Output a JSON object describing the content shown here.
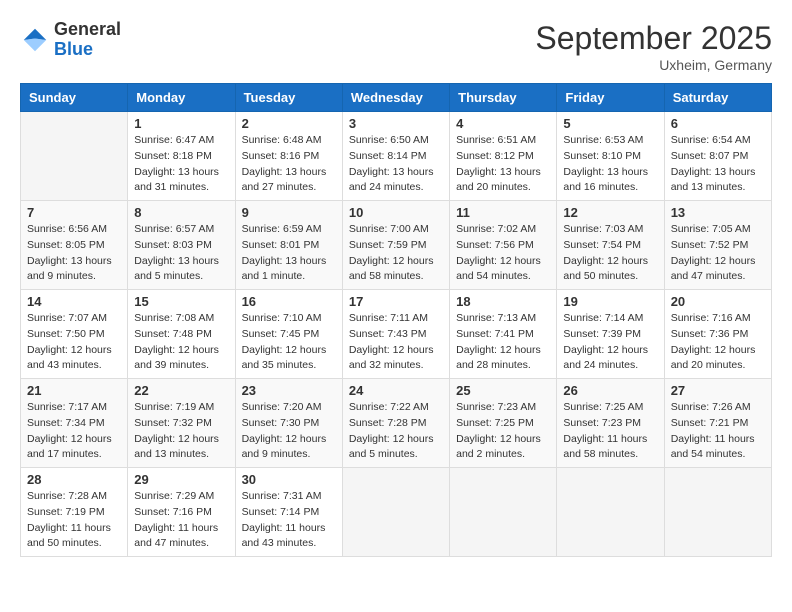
{
  "logo": {
    "general": "General",
    "blue": "Blue"
  },
  "header": {
    "month": "September 2025",
    "location": "Uxheim, Germany"
  },
  "weekdays": [
    "Sunday",
    "Monday",
    "Tuesday",
    "Wednesday",
    "Thursday",
    "Friday",
    "Saturday"
  ],
  "weeks": [
    [
      {
        "day": null
      },
      {
        "day": 1,
        "sunrise": "6:47 AM",
        "sunset": "8:18 PM",
        "daylight": "13 hours and 31 minutes."
      },
      {
        "day": 2,
        "sunrise": "6:48 AM",
        "sunset": "8:16 PM",
        "daylight": "13 hours and 27 minutes."
      },
      {
        "day": 3,
        "sunrise": "6:50 AM",
        "sunset": "8:14 PM",
        "daylight": "13 hours and 24 minutes."
      },
      {
        "day": 4,
        "sunrise": "6:51 AM",
        "sunset": "8:12 PM",
        "daylight": "13 hours and 20 minutes."
      },
      {
        "day": 5,
        "sunrise": "6:53 AM",
        "sunset": "8:10 PM",
        "daylight": "13 hours and 16 minutes."
      },
      {
        "day": 6,
        "sunrise": "6:54 AM",
        "sunset": "8:07 PM",
        "daylight": "13 hours and 13 minutes."
      }
    ],
    [
      {
        "day": 7,
        "sunrise": "6:56 AM",
        "sunset": "8:05 PM",
        "daylight": "13 hours and 9 minutes."
      },
      {
        "day": 8,
        "sunrise": "6:57 AM",
        "sunset": "8:03 PM",
        "daylight": "13 hours and 5 minutes."
      },
      {
        "day": 9,
        "sunrise": "6:59 AM",
        "sunset": "8:01 PM",
        "daylight": "13 hours and 1 minute."
      },
      {
        "day": 10,
        "sunrise": "7:00 AM",
        "sunset": "7:59 PM",
        "daylight": "12 hours and 58 minutes."
      },
      {
        "day": 11,
        "sunrise": "7:02 AM",
        "sunset": "7:56 PM",
        "daylight": "12 hours and 54 minutes."
      },
      {
        "day": 12,
        "sunrise": "7:03 AM",
        "sunset": "7:54 PM",
        "daylight": "12 hours and 50 minutes."
      },
      {
        "day": 13,
        "sunrise": "7:05 AM",
        "sunset": "7:52 PM",
        "daylight": "12 hours and 47 minutes."
      }
    ],
    [
      {
        "day": 14,
        "sunrise": "7:07 AM",
        "sunset": "7:50 PM",
        "daylight": "12 hours and 43 minutes."
      },
      {
        "day": 15,
        "sunrise": "7:08 AM",
        "sunset": "7:48 PM",
        "daylight": "12 hours and 39 minutes."
      },
      {
        "day": 16,
        "sunrise": "7:10 AM",
        "sunset": "7:45 PM",
        "daylight": "12 hours and 35 minutes."
      },
      {
        "day": 17,
        "sunrise": "7:11 AM",
        "sunset": "7:43 PM",
        "daylight": "12 hours and 32 minutes."
      },
      {
        "day": 18,
        "sunrise": "7:13 AM",
        "sunset": "7:41 PM",
        "daylight": "12 hours and 28 minutes."
      },
      {
        "day": 19,
        "sunrise": "7:14 AM",
        "sunset": "7:39 PM",
        "daylight": "12 hours and 24 minutes."
      },
      {
        "day": 20,
        "sunrise": "7:16 AM",
        "sunset": "7:36 PM",
        "daylight": "12 hours and 20 minutes."
      }
    ],
    [
      {
        "day": 21,
        "sunrise": "7:17 AM",
        "sunset": "7:34 PM",
        "daylight": "12 hours and 17 minutes."
      },
      {
        "day": 22,
        "sunrise": "7:19 AM",
        "sunset": "7:32 PM",
        "daylight": "12 hours and 13 minutes."
      },
      {
        "day": 23,
        "sunrise": "7:20 AM",
        "sunset": "7:30 PM",
        "daylight": "12 hours and 9 minutes."
      },
      {
        "day": 24,
        "sunrise": "7:22 AM",
        "sunset": "7:28 PM",
        "daylight": "12 hours and 5 minutes."
      },
      {
        "day": 25,
        "sunrise": "7:23 AM",
        "sunset": "7:25 PM",
        "daylight": "12 hours and 2 minutes."
      },
      {
        "day": 26,
        "sunrise": "7:25 AM",
        "sunset": "7:23 PM",
        "daylight": "11 hours and 58 minutes."
      },
      {
        "day": 27,
        "sunrise": "7:26 AM",
        "sunset": "7:21 PM",
        "daylight": "11 hours and 54 minutes."
      }
    ],
    [
      {
        "day": 28,
        "sunrise": "7:28 AM",
        "sunset": "7:19 PM",
        "daylight": "11 hours and 50 minutes."
      },
      {
        "day": 29,
        "sunrise": "7:29 AM",
        "sunset": "7:16 PM",
        "daylight": "11 hours and 47 minutes."
      },
      {
        "day": 30,
        "sunrise": "7:31 AM",
        "sunset": "7:14 PM",
        "daylight": "11 hours and 43 minutes."
      },
      {
        "day": null
      },
      {
        "day": null
      },
      {
        "day": null
      },
      {
        "day": null
      }
    ]
  ],
  "labels": {
    "sunrise": "Sunrise:",
    "sunset": "Sunset:",
    "daylight": "Daylight:"
  }
}
